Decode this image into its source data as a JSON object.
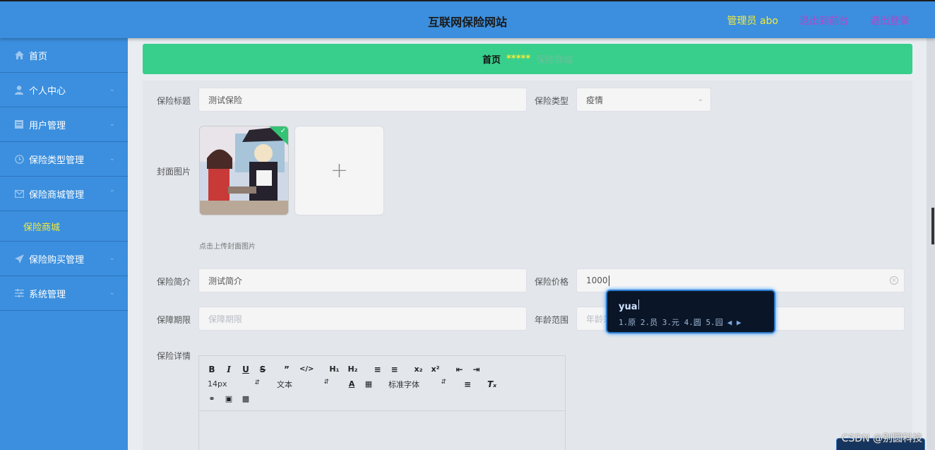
{
  "header": {
    "title": "互联网保险网站",
    "admin": "管理员 abo",
    "to_front": "退出到前台",
    "logout": "退出登录"
  },
  "sidebar": {
    "items": [
      {
        "label": "首页",
        "icon": "home-icon"
      },
      {
        "label": "个人中心",
        "icon": "user-icon"
      },
      {
        "label": "用户管理",
        "icon": "table-icon"
      },
      {
        "label": "保险类型管理",
        "icon": "clock-icon"
      },
      {
        "label": "保险商城管理",
        "icon": "mail-icon"
      },
      {
        "label": "保险商城",
        "icon": ""
      },
      {
        "label": "保险购买管理",
        "icon": "send-icon"
      },
      {
        "label": "系统管理",
        "icon": "sliders-icon"
      }
    ]
  },
  "breadcrumb": {
    "home": "首页",
    "separator": "*****",
    "current": "保险商城"
  },
  "form": {
    "title": {
      "label": "保险标题",
      "value": "测试保险"
    },
    "type": {
      "label": "保险类型",
      "value": "疫情"
    },
    "cover": {
      "label": "封面图片",
      "hint": "点击上传封面图片",
      "upload_glyph": "+"
    },
    "intro": {
      "label": "保险简介",
      "value": "测试简介"
    },
    "price": {
      "label": "保险价格",
      "value": "1000"
    },
    "period": {
      "label": "保障期限",
      "placeholder": "保障期限"
    },
    "age": {
      "label": "年龄范围",
      "placeholder": "年龄范围"
    },
    "detail": {
      "label": "保险详情"
    }
  },
  "editor": {
    "font_size": "14px",
    "text_style": "文本",
    "font_family": "标准字体"
  },
  "ime": {
    "input": "yua",
    "candidates": "1.原 2.员 3.元 4.圆 5.园"
  },
  "watermark": "CSDN @别圆科技",
  "colors": {
    "header_bg": "#3b8fde",
    "breadcrumb_bg": "#38cf8c",
    "accent_yellow": "#f4ea3a",
    "link_purple": "#b545c9"
  }
}
